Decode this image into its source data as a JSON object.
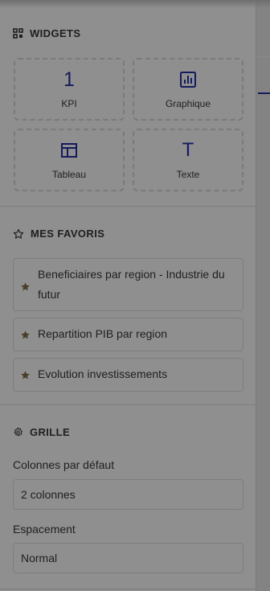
{
  "widgets": {
    "title": "WIDGETS",
    "items": [
      {
        "label": "KPI",
        "glyph": "1",
        "icon": "number-one-icon"
      },
      {
        "label": "Graphique",
        "icon": "bar-chart-icon"
      },
      {
        "label": "Tableau",
        "icon": "table-icon"
      },
      {
        "label": "Texte",
        "glyph": "T",
        "icon": "text-icon"
      }
    ]
  },
  "favorites": {
    "title": "MES FAVORIS",
    "items": [
      {
        "label": "Beneficiaires par region - Industrie du futur"
      },
      {
        "label": "Repartition PIB par region"
      },
      {
        "label": "Evolution investissements"
      }
    ]
  },
  "grid": {
    "title": "GRILLE",
    "columns_label": "Colonnes par défaut",
    "columns_value": "2 colonnes",
    "spacing_label": "Espacement",
    "spacing_value": "Normal"
  },
  "colors": {
    "accent": "#141a5e",
    "star": "#4a3f2a",
    "overlay_bg": "#8f8f8f"
  }
}
